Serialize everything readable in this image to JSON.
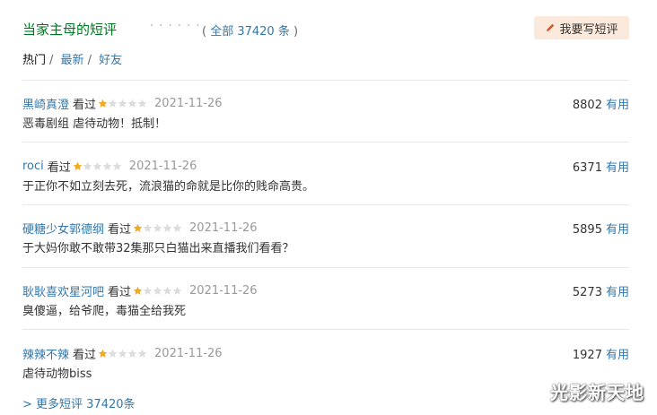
{
  "header": {
    "title": "当家主母的短评",
    "dots": "· · · · · ·",
    "count_prefix": "( ",
    "count_link": "全部 37420 条",
    "count_suffix": " )",
    "write_button": "我要写短评"
  },
  "filters": {
    "hot": "热门",
    "latest": "最新",
    "friends": "好友",
    "sep": "/"
  },
  "comments": [
    {
      "user": "黑崎真澄",
      "watched": "看过",
      "rating": 1,
      "max_rating": 5,
      "time": "2021-11-26",
      "votes": "8802",
      "useful": "有用",
      "text": "恶毒剧组 虐待动物！抵制！"
    },
    {
      "user": "roci",
      "watched": "看过",
      "rating": 1,
      "max_rating": 5,
      "time": "2021-11-26",
      "votes": "6371",
      "useful": "有用",
      "text": "于正你不如立刻去死，流浪猫的命就是比你的贱命高贵。"
    },
    {
      "user": "硬糖少女郭德纲",
      "watched": "看过",
      "rating": 1,
      "max_rating": 5,
      "time": "2021-11-26",
      "votes": "5895",
      "useful": "有用",
      "text": "于大妈你敢不敢带32集那只白猫出来直播我们看看？"
    },
    {
      "user": "耿耿喜欢星河吧",
      "watched": "看过",
      "rating": 1,
      "max_rating": 5,
      "time": "2021-11-26",
      "votes": "5273",
      "useful": "有用",
      "text": "臭傻逼，给爷爬，毒猫全给我死"
    },
    {
      "user": "辣辣不辣",
      "watched": "看过",
      "rating": 1,
      "max_rating": 5,
      "time": "2021-11-26",
      "votes": "1927",
      "useful": "有用",
      "text": "虐待动物biss"
    }
  ],
  "more_link": "> 更多短评 37420条",
  "watermark": "光影新天地",
  "colors": {
    "title": "#007722",
    "link": "#3377aa",
    "star_on": "#f0ab24",
    "star_off": "#dddddd",
    "button_bg": "#fbe9dc"
  }
}
